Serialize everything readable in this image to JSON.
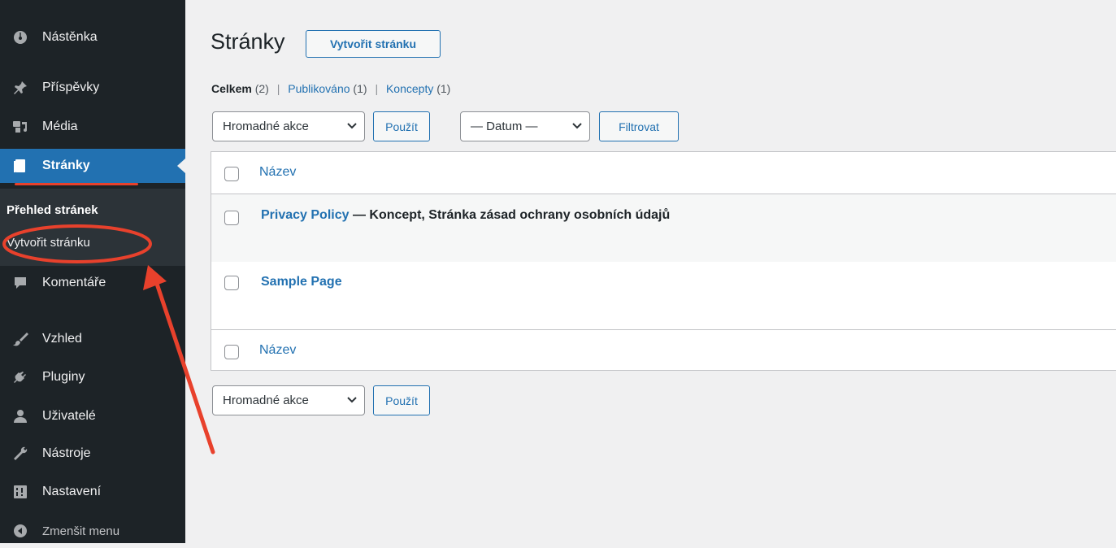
{
  "sidebar": {
    "items": [
      {
        "label": "Nástěnka",
        "icon": "dashboard-icon"
      },
      {
        "label": "Příspěvky",
        "icon": "pin-icon"
      },
      {
        "label": "Média",
        "icon": "media-icon"
      },
      {
        "label": "Stránky",
        "icon": "page-icon"
      },
      {
        "label": "Komentáře",
        "icon": "comment-icon"
      },
      {
        "label": "Vzhled",
        "icon": "brush-icon"
      },
      {
        "label": "Pluginy",
        "icon": "plugin-icon"
      },
      {
        "label": "Uživatelé",
        "icon": "user-icon"
      },
      {
        "label": "Nástroje",
        "icon": "wrench-icon"
      },
      {
        "label": "Nastavení",
        "icon": "settings-icon"
      }
    ],
    "submenu": {
      "overview": "Přehled stránek",
      "add_new": "Vytvořit stránku"
    },
    "collapse": "Zmenšit menu"
  },
  "header": {
    "title": "Stránky",
    "add_new_button": "Vytvořit stránku"
  },
  "filters_links": {
    "all": "Celkem",
    "all_count": "(2)",
    "published": "Publikováno",
    "published_count": "(1)",
    "drafts": "Koncepty",
    "drafts_count": "(1)",
    "separator": "|"
  },
  "toolbar": {
    "bulk_actions": "Hromadné akce",
    "apply": "Použít",
    "date_filter": "— Datum —",
    "filter": "Filtrovat"
  },
  "table": {
    "column_title": "Název",
    "rows": [
      {
        "title": "Privacy Policy",
        "state": " — Koncept, Stránka zásad ochrany osobních údajů"
      },
      {
        "title": "Sample Page",
        "state": ""
      }
    ]
  },
  "colors": {
    "sidebar_bg": "#1d2327",
    "active": "#2271b1",
    "link": "#2271b1",
    "annotation": "#e8412c"
  }
}
